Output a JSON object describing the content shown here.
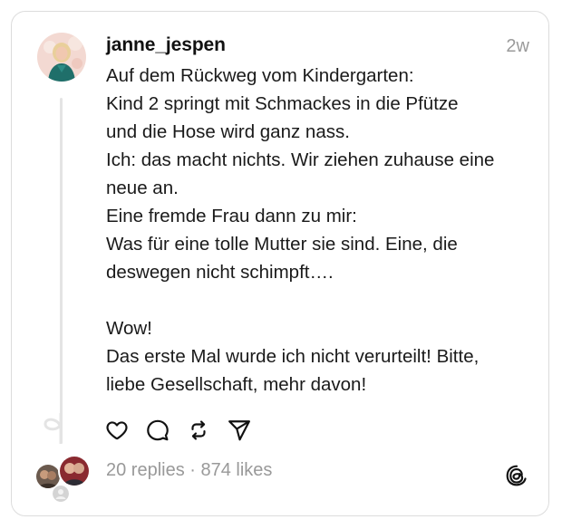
{
  "post": {
    "username": "janne_jespen",
    "timestamp": "2w",
    "lines": [
      "Auf dem Rückweg vom Kindergarten:",
      "Kind 2 springt mit Schmackes in die Pfütze",
      "und die Hose wird ganz nass.",
      "Ich: das macht nichts. Wir ziehen zuhause eine",
      "neue an.",
      "Eine fremde Frau dann zu mir:",
      "Was für eine tolle Mutter sie sind. Eine, die",
      "deswegen nicht schimpft….",
      "",
      "Wow!",
      "Das erste Mal wurde ich nicht verurteilt! Bitte,",
      "liebe Gesellschaft, mehr davon!"
    ]
  },
  "actions": [
    {
      "name": "like",
      "icon": "heart-icon"
    },
    {
      "name": "reply",
      "icon": "comment-icon"
    },
    {
      "name": "repost",
      "icon": "repost-icon"
    },
    {
      "name": "share",
      "icon": "send-icon"
    }
  ],
  "footer": {
    "stats_text": "20 replies · 874 likes",
    "logo_icon": "threads-logo-icon"
  },
  "colors": {
    "text": "#111111",
    "muted": "#999999",
    "border": "#dcdcdc",
    "thread_line": "#e4e4e4"
  }
}
